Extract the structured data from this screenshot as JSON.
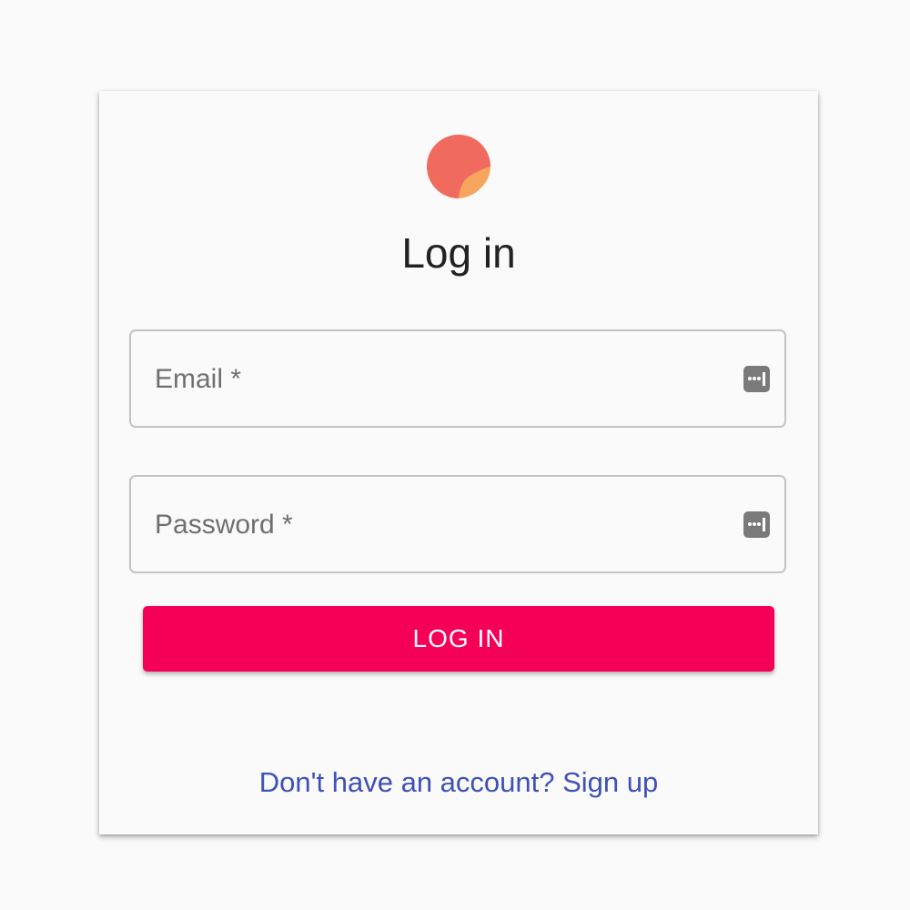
{
  "logo": {
    "icon": "sticker-peel-logo-icon",
    "colors": {
      "main": "#f06a5e",
      "peel": "#f7a55d"
    }
  },
  "title": "Log in",
  "fields": {
    "email": {
      "label": "Email *",
      "value": "",
      "icon": "password-manager-icon"
    },
    "password": {
      "label": "Password *",
      "value": "",
      "icon": "password-manager-icon"
    }
  },
  "login_button": {
    "label": "LOG IN",
    "color": "#f50057"
  },
  "signup_link": {
    "label": "Don't have an account? Sign up",
    "color": "#3f51b5"
  }
}
